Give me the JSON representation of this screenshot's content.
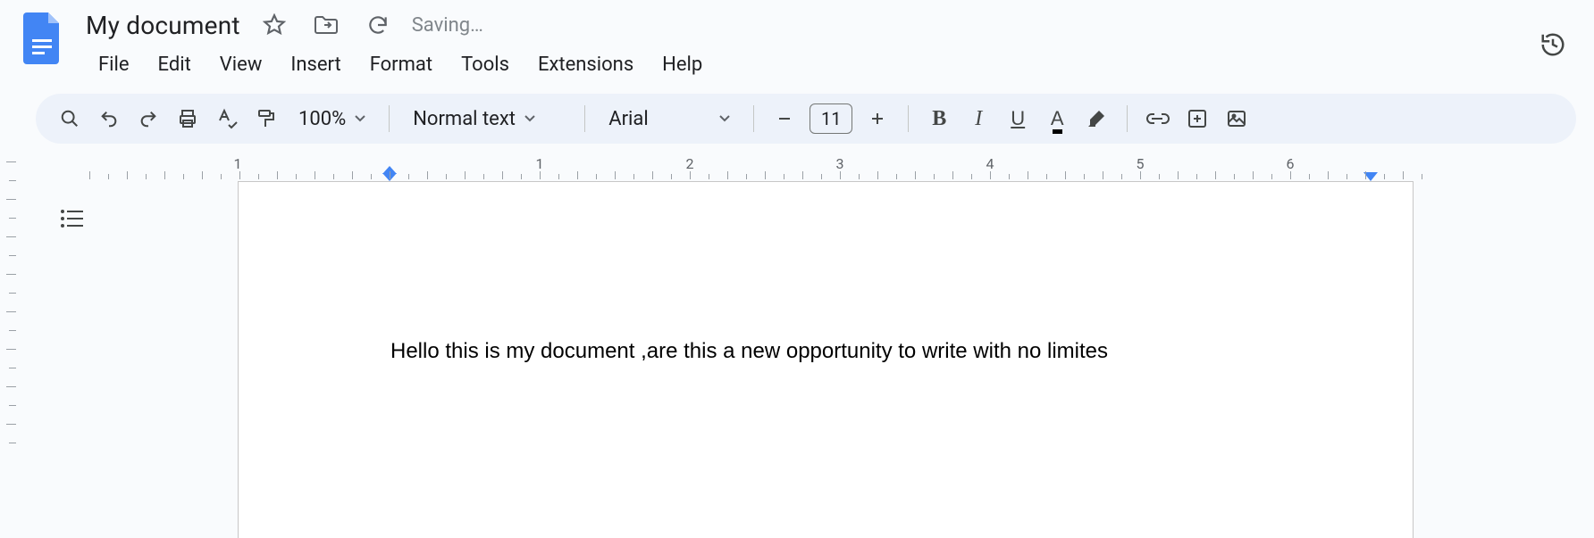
{
  "header": {
    "title": "My document",
    "status": "Saving…"
  },
  "menu": [
    "File",
    "Edit",
    "View",
    "Insert",
    "Format",
    "Tools",
    "Extensions",
    "Help"
  ],
  "toolbar": {
    "zoom": "100%",
    "style": "Normal text",
    "font": "Arial",
    "font_size": "11"
  },
  "ruler": {
    "numbers": [
      1,
      1,
      2,
      3,
      4,
      5,
      6
    ]
  },
  "document": {
    "body": "Hello this is my document ,are this a new opportunity to write with no limites"
  }
}
